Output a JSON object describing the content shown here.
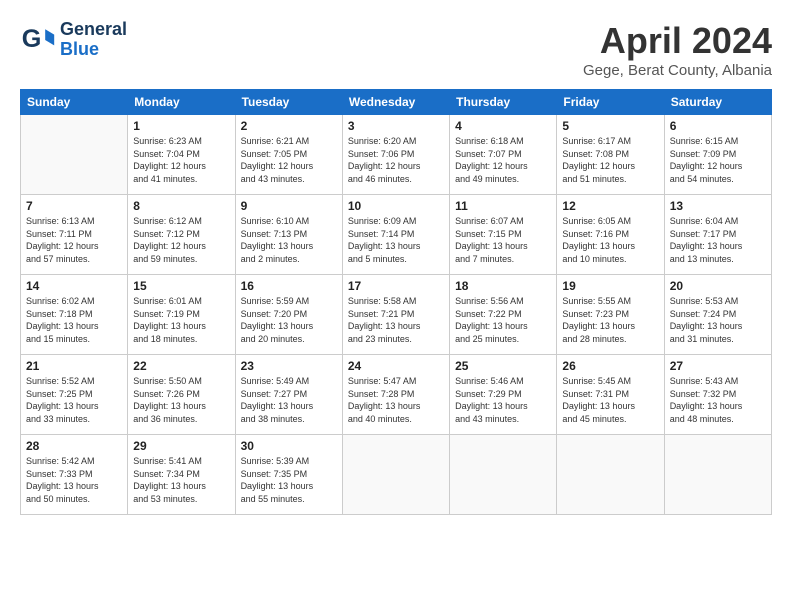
{
  "logo": {
    "line1": "General",
    "line2": "Blue"
  },
  "title": "April 2024",
  "location": "Gege, Berat County, Albania",
  "days_of_week": [
    "Sunday",
    "Monday",
    "Tuesday",
    "Wednesday",
    "Thursday",
    "Friday",
    "Saturday"
  ],
  "weeks": [
    [
      {
        "day": "",
        "info": ""
      },
      {
        "day": "1",
        "info": "Sunrise: 6:23 AM\nSunset: 7:04 PM\nDaylight: 12 hours\nand 41 minutes."
      },
      {
        "day": "2",
        "info": "Sunrise: 6:21 AM\nSunset: 7:05 PM\nDaylight: 12 hours\nand 43 minutes."
      },
      {
        "day": "3",
        "info": "Sunrise: 6:20 AM\nSunset: 7:06 PM\nDaylight: 12 hours\nand 46 minutes."
      },
      {
        "day": "4",
        "info": "Sunrise: 6:18 AM\nSunset: 7:07 PM\nDaylight: 12 hours\nand 49 minutes."
      },
      {
        "day": "5",
        "info": "Sunrise: 6:17 AM\nSunset: 7:08 PM\nDaylight: 12 hours\nand 51 minutes."
      },
      {
        "day": "6",
        "info": "Sunrise: 6:15 AM\nSunset: 7:09 PM\nDaylight: 12 hours\nand 54 minutes."
      }
    ],
    [
      {
        "day": "7",
        "info": "Sunrise: 6:13 AM\nSunset: 7:11 PM\nDaylight: 12 hours\nand 57 minutes."
      },
      {
        "day": "8",
        "info": "Sunrise: 6:12 AM\nSunset: 7:12 PM\nDaylight: 12 hours\nand 59 minutes."
      },
      {
        "day": "9",
        "info": "Sunrise: 6:10 AM\nSunset: 7:13 PM\nDaylight: 13 hours\nand 2 minutes."
      },
      {
        "day": "10",
        "info": "Sunrise: 6:09 AM\nSunset: 7:14 PM\nDaylight: 13 hours\nand 5 minutes."
      },
      {
        "day": "11",
        "info": "Sunrise: 6:07 AM\nSunset: 7:15 PM\nDaylight: 13 hours\nand 7 minutes."
      },
      {
        "day": "12",
        "info": "Sunrise: 6:05 AM\nSunset: 7:16 PM\nDaylight: 13 hours\nand 10 minutes."
      },
      {
        "day": "13",
        "info": "Sunrise: 6:04 AM\nSunset: 7:17 PM\nDaylight: 13 hours\nand 13 minutes."
      }
    ],
    [
      {
        "day": "14",
        "info": "Sunrise: 6:02 AM\nSunset: 7:18 PM\nDaylight: 13 hours\nand 15 minutes."
      },
      {
        "day": "15",
        "info": "Sunrise: 6:01 AM\nSunset: 7:19 PM\nDaylight: 13 hours\nand 18 minutes."
      },
      {
        "day": "16",
        "info": "Sunrise: 5:59 AM\nSunset: 7:20 PM\nDaylight: 13 hours\nand 20 minutes."
      },
      {
        "day": "17",
        "info": "Sunrise: 5:58 AM\nSunset: 7:21 PM\nDaylight: 13 hours\nand 23 minutes."
      },
      {
        "day": "18",
        "info": "Sunrise: 5:56 AM\nSunset: 7:22 PM\nDaylight: 13 hours\nand 25 minutes."
      },
      {
        "day": "19",
        "info": "Sunrise: 5:55 AM\nSunset: 7:23 PM\nDaylight: 13 hours\nand 28 minutes."
      },
      {
        "day": "20",
        "info": "Sunrise: 5:53 AM\nSunset: 7:24 PM\nDaylight: 13 hours\nand 31 minutes."
      }
    ],
    [
      {
        "day": "21",
        "info": "Sunrise: 5:52 AM\nSunset: 7:25 PM\nDaylight: 13 hours\nand 33 minutes."
      },
      {
        "day": "22",
        "info": "Sunrise: 5:50 AM\nSunset: 7:26 PM\nDaylight: 13 hours\nand 36 minutes."
      },
      {
        "day": "23",
        "info": "Sunrise: 5:49 AM\nSunset: 7:27 PM\nDaylight: 13 hours\nand 38 minutes."
      },
      {
        "day": "24",
        "info": "Sunrise: 5:47 AM\nSunset: 7:28 PM\nDaylight: 13 hours\nand 40 minutes."
      },
      {
        "day": "25",
        "info": "Sunrise: 5:46 AM\nSunset: 7:29 PM\nDaylight: 13 hours\nand 43 minutes."
      },
      {
        "day": "26",
        "info": "Sunrise: 5:45 AM\nSunset: 7:31 PM\nDaylight: 13 hours\nand 45 minutes."
      },
      {
        "day": "27",
        "info": "Sunrise: 5:43 AM\nSunset: 7:32 PM\nDaylight: 13 hours\nand 48 minutes."
      }
    ],
    [
      {
        "day": "28",
        "info": "Sunrise: 5:42 AM\nSunset: 7:33 PM\nDaylight: 13 hours\nand 50 minutes."
      },
      {
        "day": "29",
        "info": "Sunrise: 5:41 AM\nSunset: 7:34 PM\nDaylight: 13 hours\nand 53 minutes."
      },
      {
        "day": "30",
        "info": "Sunrise: 5:39 AM\nSunset: 7:35 PM\nDaylight: 13 hours\nand 55 minutes."
      },
      {
        "day": "",
        "info": ""
      },
      {
        "day": "",
        "info": ""
      },
      {
        "day": "",
        "info": ""
      },
      {
        "day": "",
        "info": ""
      }
    ]
  ]
}
